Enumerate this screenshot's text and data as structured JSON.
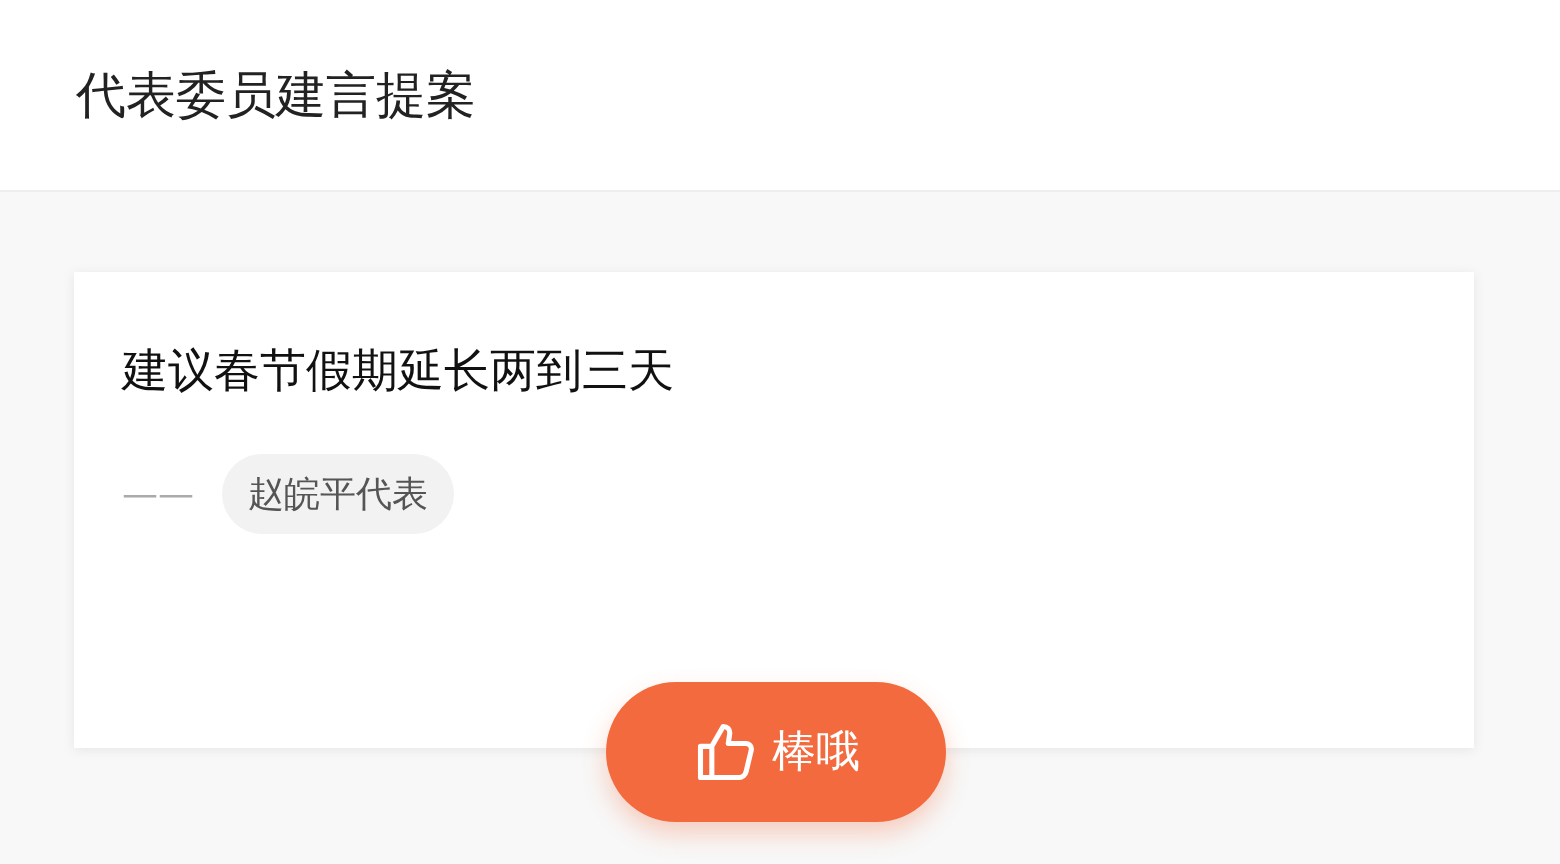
{
  "header": {
    "title": "代表委员建言提案"
  },
  "card": {
    "title": "建议春节假期延长两到三天",
    "author_prefix": "——",
    "author": "赵皖平代表"
  },
  "like_button": {
    "label": "棒哦"
  }
}
